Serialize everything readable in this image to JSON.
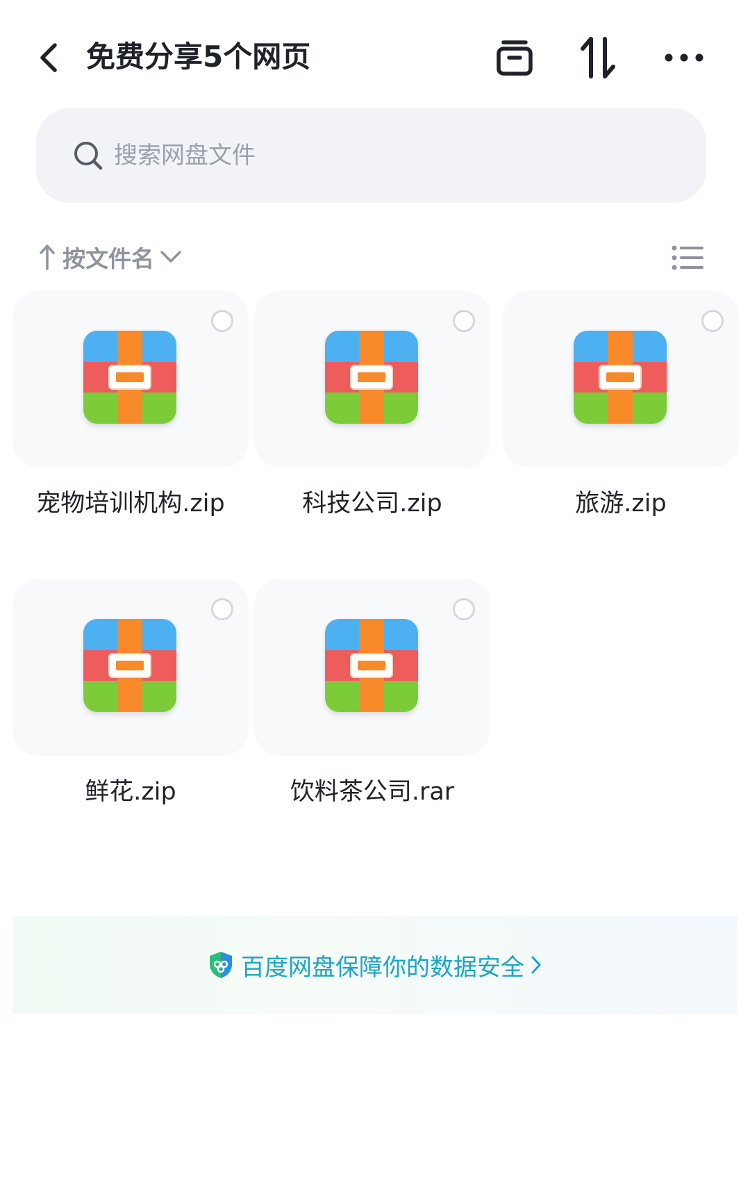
{
  "header": {
    "title": "免费分享5个网页",
    "back_icon": "chevron-left-icon",
    "actions": [
      "archive-icon",
      "sort-icon",
      "more-icon"
    ]
  },
  "search": {
    "placeholder": "搜索网盘文件",
    "value": ""
  },
  "sort": {
    "label": "按文件名",
    "direction": "ascending"
  },
  "files": [
    {
      "name": "宠物培训机构.zip",
      "type": "archive"
    },
    {
      "name": "科技公司.zip",
      "type": "archive"
    },
    {
      "name": "旅游.zip",
      "type": "archive"
    },
    {
      "name": "鲜花.zip",
      "type": "archive"
    },
    {
      "name": "饮料茶公司.rar",
      "type": "archive"
    }
  ],
  "footer": {
    "text": "百度网盘保障你的数据安全"
  },
  "colors": {
    "accent_teal": "#1aa6c4",
    "text_primary": "#1f2329",
    "text_muted": "#8e939d",
    "search_bg": "#f2f3f7",
    "card_bg": "#f8f9fb"
  }
}
